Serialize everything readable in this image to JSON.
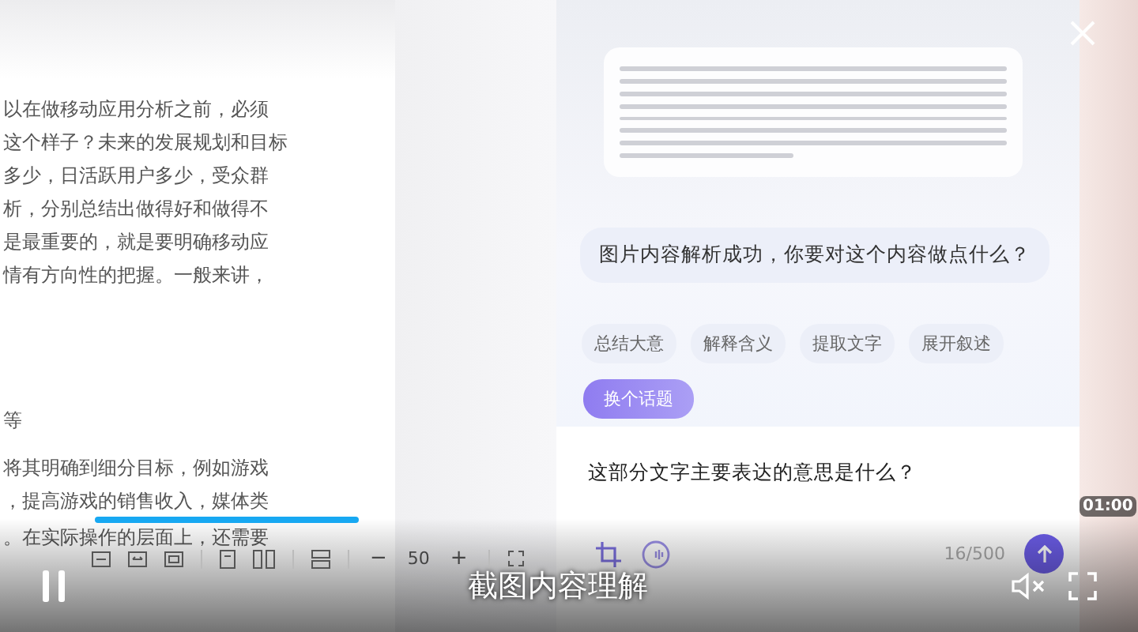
{
  "document": {
    "lines": [
      {
        "text": "以在做移动应用分析之前，必须",
        "kind": "body"
      },
      {
        "text": "这个样子？未来的发展规划和目标",
        "kind": "body"
      },
      {
        "text": "多少，日活跃用户多少，受众群",
        "kind": "body"
      },
      {
        "text": "析，分别总结出做得好和做得不",
        "kind": "body"
      },
      {
        "text": "是最重要的，就是要明确移动应",
        "kind": "body"
      },
      {
        "text": "情有方向性的把握。一般来讲，",
        "kind": "body"
      },
      {
        "text": "等",
        "kind": "heading"
      },
      {
        "text": "将其明确到细分目标，例如游戏",
        "kind": "body"
      },
      {
        "text": "，提高游戏的销售收入，媒体类",
        "kind": "body"
      },
      {
        "text": "。在实际操作的层面上，还需要",
        "kind": "body"
      }
    ],
    "toolbar": {
      "minus": "−",
      "zoom": "50",
      "plus": "+"
    }
  },
  "chat": {
    "reply": "图片内容解析成功，你要对这个内容做点什么？",
    "suggestions": [
      {
        "label": "总结大意"
      },
      {
        "label": "解释含义"
      },
      {
        "label": "提取文字"
      },
      {
        "label": "展开叙述"
      }
    ],
    "change_topic": "换个话题",
    "input": {
      "value": "这部分文字主要表达的意思是什么？",
      "counter": "16/500"
    }
  },
  "player": {
    "progress": {
      "level": 0.27
    },
    "time": "01:00",
    "subtitle": "截图内容理解",
    "playing": true,
    "muted": true
  }
}
